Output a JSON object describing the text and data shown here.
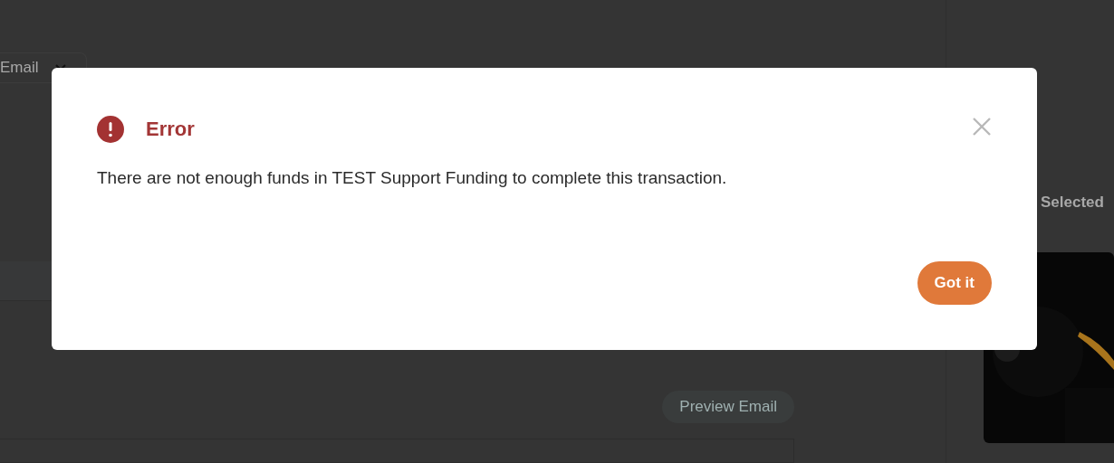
{
  "page": {
    "channel_select": {
      "value": "Email"
    },
    "side_panel": {
      "heading": "Selected"
    },
    "preview_button": "Preview Email"
  },
  "dialog": {
    "title": "Error",
    "message": "There are not enough funds in TEST Support Funding to complete this transaction.",
    "button": "Got it"
  }
}
